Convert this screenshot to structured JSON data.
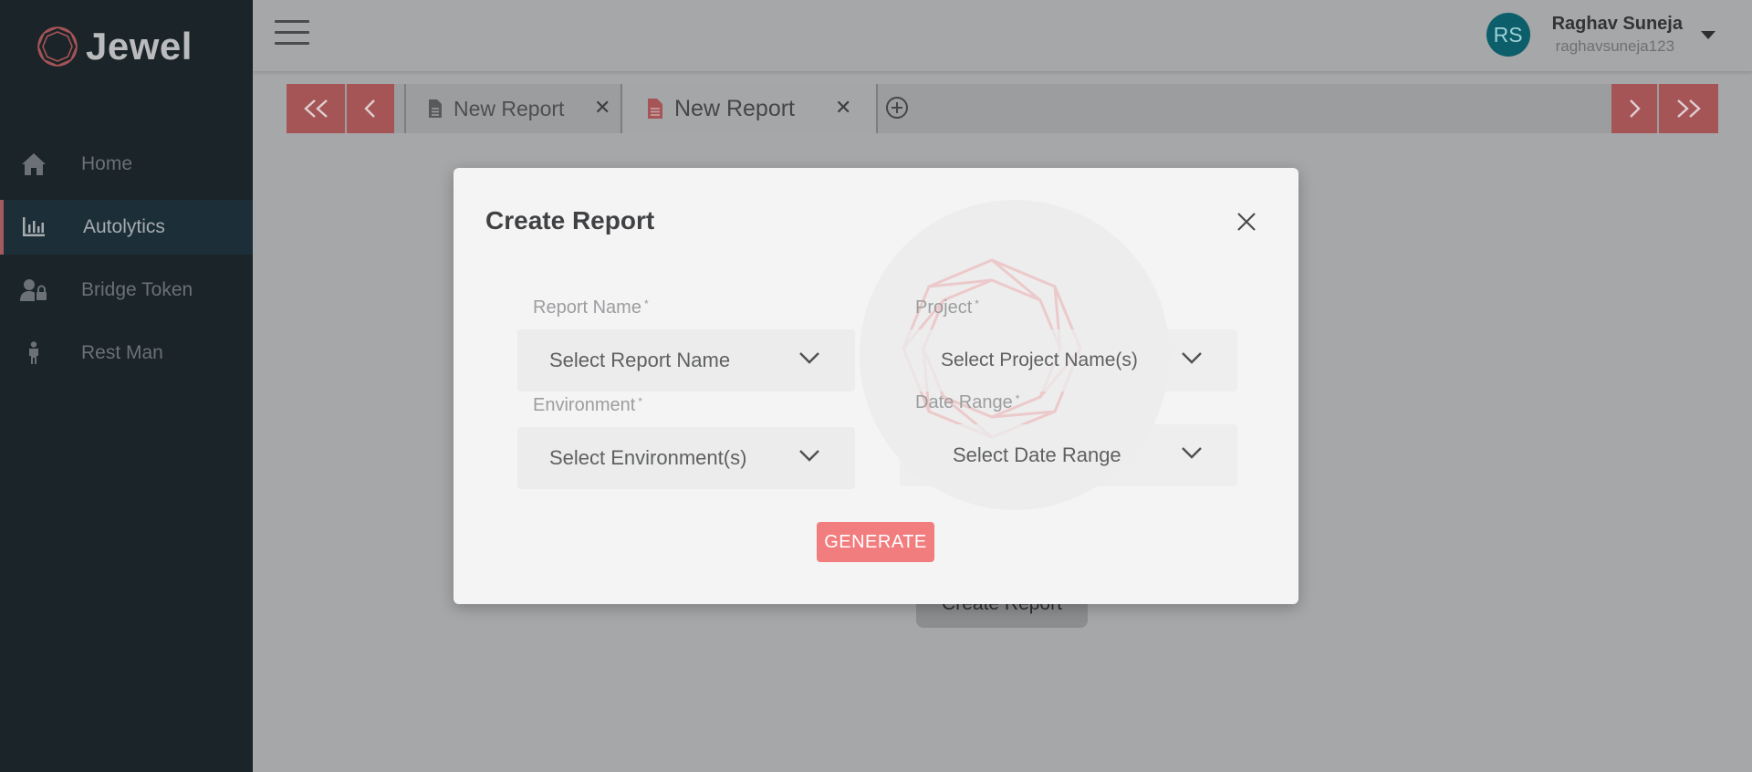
{
  "app": {
    "logo_text": "Jewel",
    "brand_color": "#a65557"
  },
  "sidebar": {
    "items": [
      {
        "label": "Home",
        "icon": "home-icon",
        "active": false
      },
      {
        "label": "Autolytics",
        "icon": "bar-chart-icon",
        "active": true
      },
      {
        "label": "Bridge Token",
        "icon": "user-lock-icon",
        "active": false
      },
      {
        "label": "Rest Man",
        "icon": "person-icon",
        "active": false
      }
    ]
  },
  "header": {
    "avatar_initials": "RS",
    "user_name": "Raghav Suneja",
    "user_handle": "raghavsuneja123"
  },
  "tabs": {
    "items": [
      {
        "label": "New Report",
        "close": "✕",
        "active": false
      },
      {
        "label": "New Report",
        "close": "✕",
        "active": true
      }
    ]
  },
  "background": {
    "create_report_button": "Create Report"
  },
  "modal": {
    "title": "Create Report",
    "fields": {
      "report_name": {
        "label": "Report Name",
        "required": "*",
        "value": "Select Report Name"
      },
      "project": {
        "label": "Project",
        "required": "*",
        "value": "Select Project Name(s)"
      },
      "environment": {
        "label": "Environment",
        "required": "*",
        "value": "Select Environment(s)"
      },
      "date_range": {
        "label": "Date Range",
        "required": "*",
        "value": "Select Date Range"
      }
    },
    "generate_label": "GENERATE",
    "generate_color": "#f27d7f"
  }
}
